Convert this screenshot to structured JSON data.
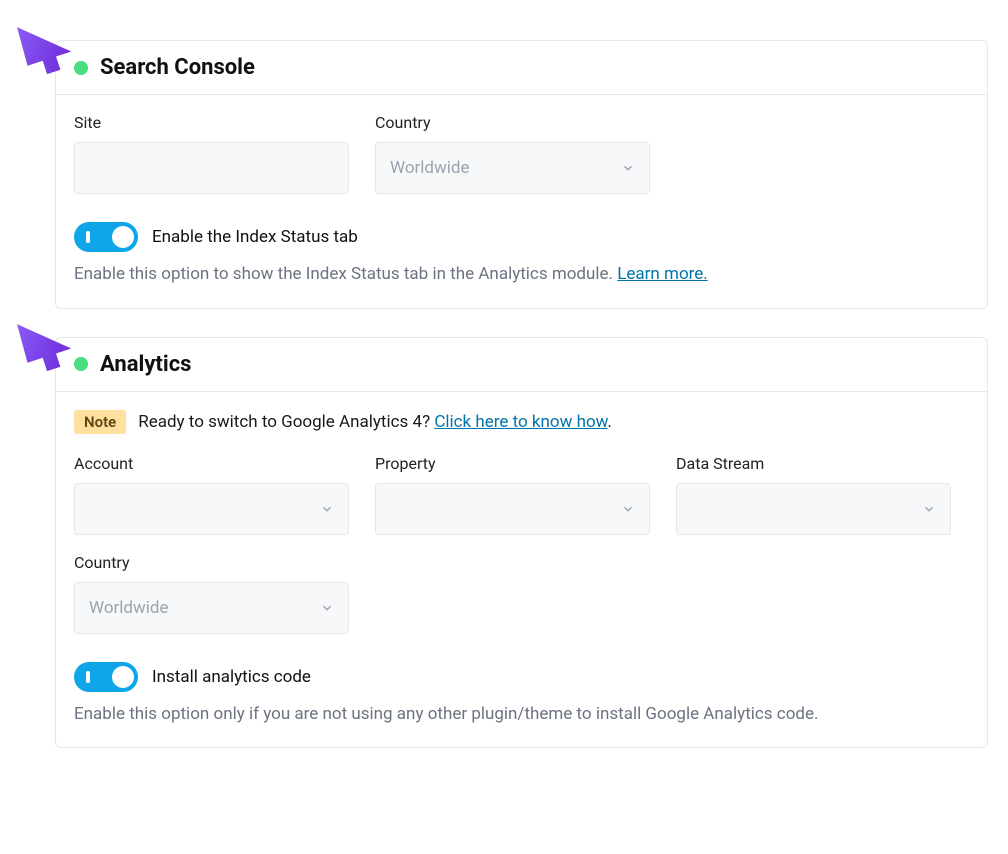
{
  "search_console": {
    "title": "Search Console",
    "site_label": "Site",
    "site_value": "",
    "country_label": "Country",
    "country_value": "Worldwide",
    "toggle_label": "Enable the Index Status tab",
    "help_text_prefix": "Enable this option to show the Index Status tab in the Analytics module. ",
    "learn_more": "Learn more."
  },
  "analytics": {
    "title": "Analytics",
    "note_label": "Note",
    "note_text": "Ready to switch to Google Analytics 4? ",
    "note_link": "Click here to know how",
    "note_period": ".",
    "account_label": "Account",
    "property_label": "Property",
    "data_stream_label": "Data Stream",
    "country_label": "Country",
    "country_value": "Worldwide",
    "toggle_label": "Install analytics code",
    "help_text": "Enable this option only if you are not using any other plugin/theme to install Google Analytics code."
  }
}
